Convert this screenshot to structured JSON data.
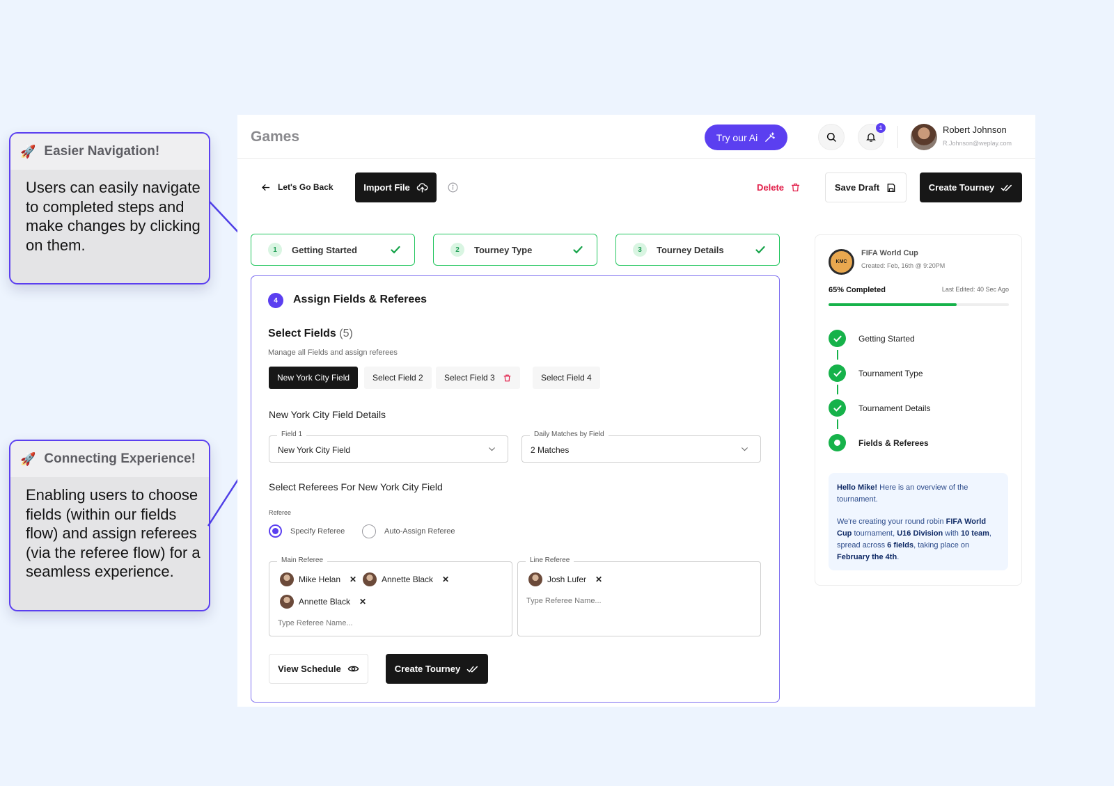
{
  "callouts": [
    {
      "title": "Easier Navigation!",
      "body": "Users can easily navigate to completed steps and make changes by clicking on them."
    },
    {
      "title": "Connecting Experience!",
      "body": "Enabling users to choose fields (within our fields flow) and assign referees (via the referee flow) for a seamless experience."
    }
  ],
  "header": {
    "title": "Games",
    "ai_button": "Try our Ai",
    "notification_count": "1",
    "user": {
      "name": "Robert Johnson",
      "email": "R.Johnson@weplay.com"
    }
  },
  "toolbar": {
    "back": "Let's Go Back",
    "import": "Import File",
    "delete": "Delete",
    "save_draft": "Save Draft",
    "create": "Create Tourney"
  },
  "steps": [
    {
      "num": "1",
      "label": "Getting Started"
    },
    {
      "num": "2",
      "label": "Tourney Type"
    },
    {
      "num": "3",
      "label": "Tourney Details"
    }
  ],
  "form": {
    "step_num": "4",
    "title": "Assign Fields & Referees",
    "select_fields_title": "Select Fields",
    "select_fields_count": "(5)",
    "select_fields_sub": "Manage all Fields and assign referees",
    "fields": [
      "New York City Field",
      "Select Field 2",
      "Select Field 3",
      "Select Field 4"
    ],
    "details_title": "New York City Field Details",
    "field1": {
      "legend": "Field 1",
      "value": "New York City Field"
    },
    "daily": {
      "legend": "Daily Matches by Field",
      "value": "2 Matches"
    },
    "referees_title": "Select Referees For New York City Field",
    "referee_label": "Referee",
    "radio_specify": "Specify Referee",
    "radio_auto": "Auto-Assign Referee",
    "main_referee": {
      "legend": "Main Referee",
      "names": [
        "Mike Helan",
        "Annette Black",
        "Annette Black"
      ],
      "placeholder": "Type Referee Name..."
    },
    "line_referee": {
      "legend": "Line Referee",
      "names": [
        "Josh Lufer"
      ],
      "placeholder": "Type Referee Name..."
    },
    "view_schedule": "View Schedule",
    "create": "Create Tourney"
  },
  "sidebar": {
    "logo_text": "KMC",
    "tournament": "FIFA World Cup",
    "created": "Created: Feb, 16th @ 9:20PM",
    "completed_label": "65% Completed",
    "progress": 0.71,
    "last_edited": "Last Edited: 40 Sec Ago",
    "timeline": [
      "Getting Started",
      "Tournament Type",
      "Tournament Details",
      "Fields & Referees"
    ],
    "info": {
      "greeting": "Hello Mike!",
      "line1": " Here is an overview of the tournament.",
      "p2a": "We're creating your round robin ",
      "p2b": "FIFA World Cup",
      "p2c": " tournament, ",
      "p2d": "U16 Division",
      "p2e": " with ",
      "p2f": "10 team",
      "p2g": ", spread across ",
      "p2h": "6 fields",
      "p2i": ", taking place on ",
      "p2j": "February the 4th",
      "p2k": "."
    }
  },
  "colors": {
    "accent": "#5b3ff0",
    "success": "#16b24a",
    "danger": "#e11d48",
    "dark": "#171717"
  }
}
